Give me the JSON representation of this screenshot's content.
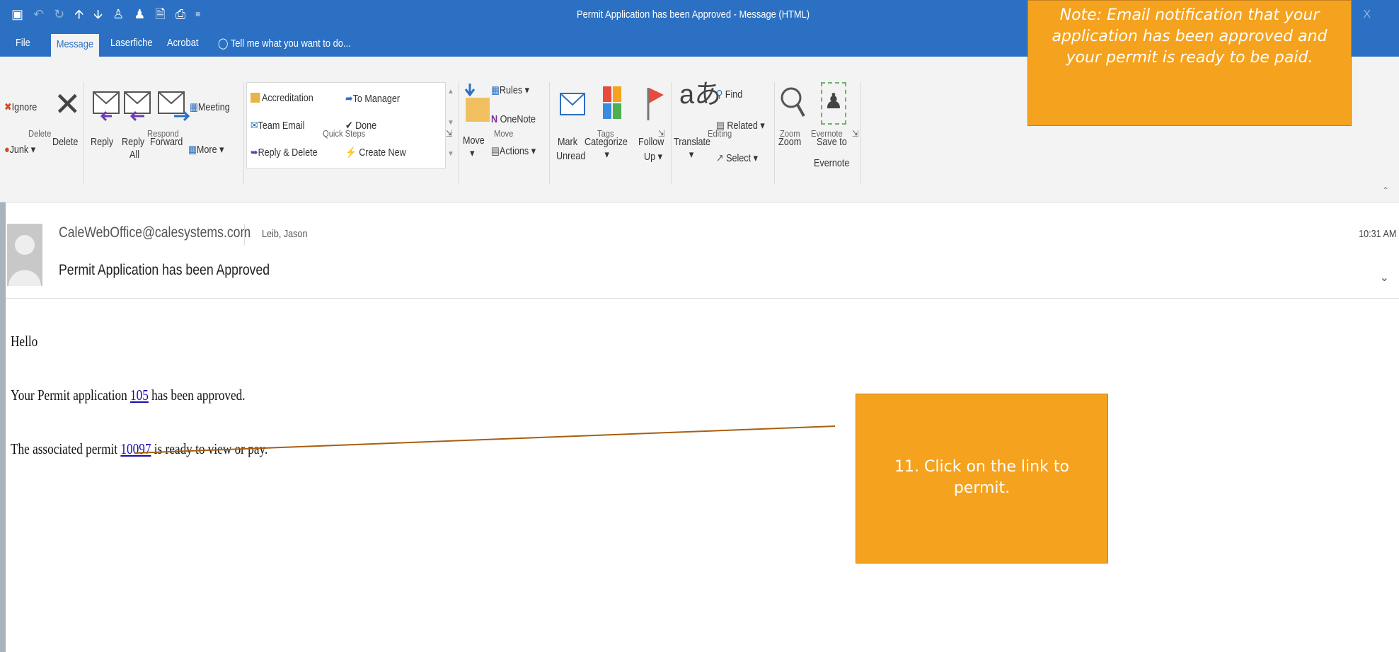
{
  "window": {
    "title": "Permit Application has been Approved - Message (HTML)",
    "close": "X"
  },
  "tabs": [
    "File",
    "Message",
    "Laserfiche",
    "Acrobat"
  ],
  "tell_me": "Tell me what you want to do...",
  "ribbon": {
    "delete_group": {
      "ignore": "Ignore",
      "junk": "Junk",
      "delete": "Delete",
      "label": "Delete"
    },
    "respond_group": {
      "reply": "Reply",
      "reply_all_1": "Reply",
      "reply_all_2": "All",
      "forward": "Forward",
      "meeting": "Meeting",
      "more": "More",
      "label": "Respond"
    },
    "quick_steps": {
      "accreditation": "Accreditation",
      "to_manager": "To Manager",
      "team_email": "Team Email",
      "done": "Done",
      "reply_delete": "Reply & Delete",
      "create_new": "Create New",
      "label": "Quick Steps"
    },
    "move_group": {
      "move": "Move",
      "rules": "Rules",
      "onenote": "OneNote",
      "actions": "Actions",
      "label": "Move"
    },
    "tags_group": {
      "mark": "Mark",
      "unread": "Unread",
      "categorize": "Categorize",
      "follow": "Follow",
      "up": "Up",
      "label": "Tags"
    },
    "editing_group": {
      "translate": "Translate",
      "find": "Find",
      "related": "Related",
      "select": "Select",
      "label": "Editing"
    },
    "zoom_group": {
      "zoom": "Zoom",
      "label": "Zoom"
    },
    "evernote_group": {
      "save_to": "Save to",
      "evernote": "Evernote",
      "label": "Evernote"
    }
  },
  "message": {
    "from": "CaleWebOffice@calesystems.com",
    "to": "Leib, Jason",
    "subject": "Permit Application has been Approved",
    "time": "10:31 AM"
  },
  "body": {
    "greeting": "Hello",
    "line1_prefix": "Your Permit application ",
    "line1_link": "105",
    "line1_suffix": " has been approved.",
    "line2_prefix": "The associated permit ",
    "line2_link": "10097",
    "line2_suffix": " is ready to view or pay."
  },
  "annotations": {
    "note": "Note:  Email notification that your application has been approved and your permit is ready to be paid.",
    "step": "11.  Click on the link to permit."
  },
  "colors": {
    "outlook_blue": "#2b70c2",
    "callout_orange": "#f5a21e",
    "link": "#1a0dab"
  }
}
